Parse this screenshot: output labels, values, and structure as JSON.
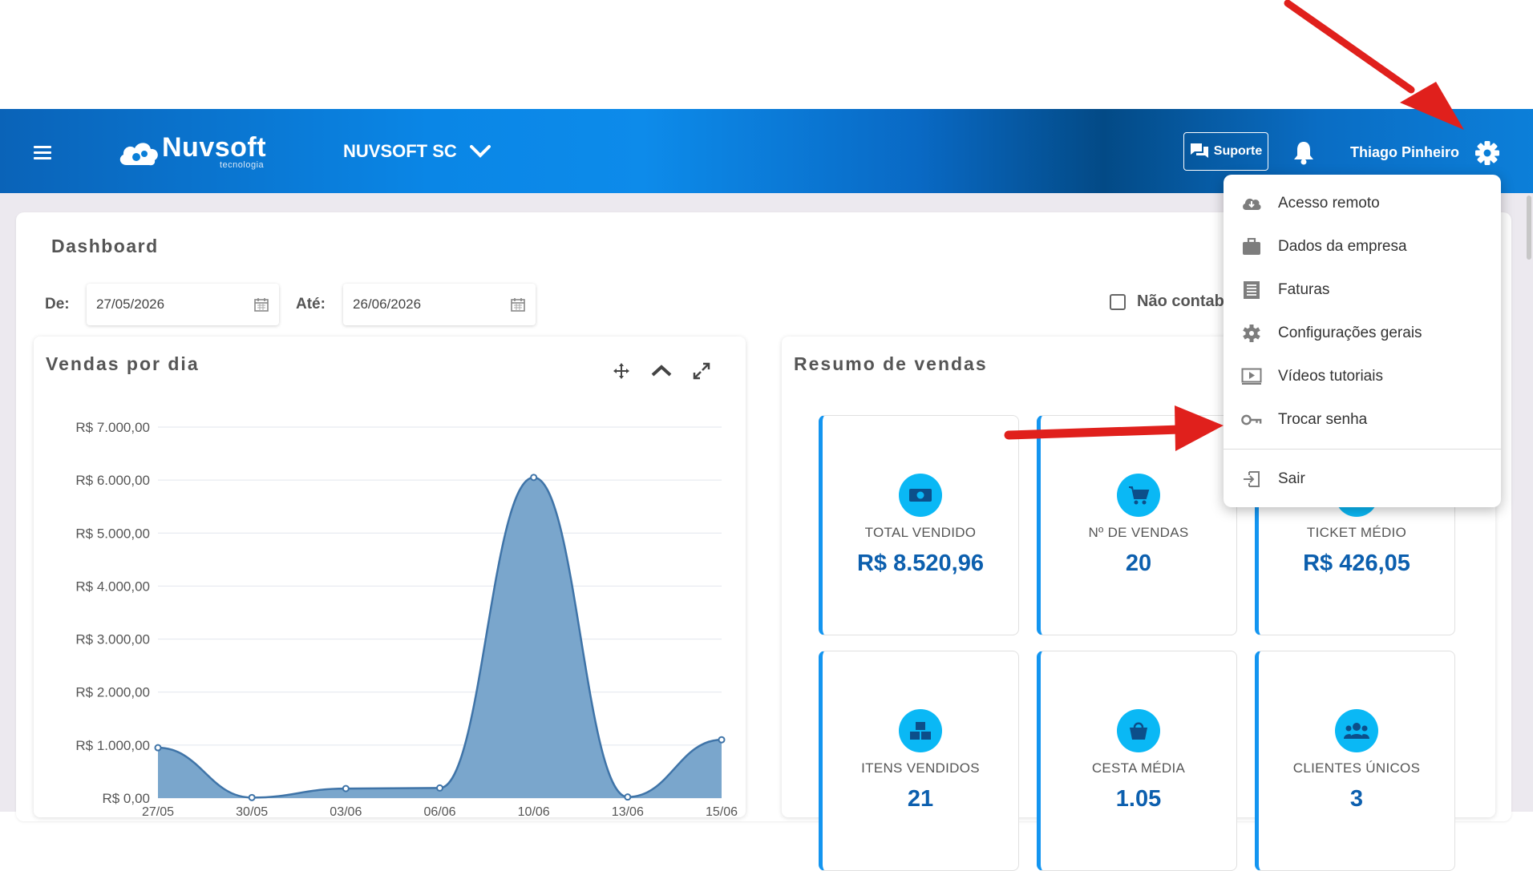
{
  "header": {
    "brand": "Nuvsoft",
    "brand_sub": "tecnologia",
    "company": "NUVSOFT SC",
    "support_label": "Suporte",
    "user_name": "Thiago Pinheiro"
  },
  "page": {
    "title": "Dashboard",
    "from_label": "De:",
    "from_value": "27/05/2026",
    "to_label": "Até:",
    "to_value": "26/06/2026",
    "checkbox_label": "Não contab"
  },
  "sales_chart_panel": {
    "title": "Vendas por dia"
  },
  "summary_panel": {
    "title": "Resumo de vendas",
    "cards": [
      {
        "label": "TOTAL VENDIDO",
        "value": "R$ 8.520,96",
        "icon": "money-icon"
      },
      {
        "label": "Nº DE VENDAS",
        "value": "20",
        "icon": "cart-icon"
      },
      {
        "label": "TICKET MÉDIO",
        "value": "R$ 426,05",
        "icon": "ticket-icon"
      },
      {
        "label": "ITENS VENDIDOS",
        "value": "21",
        "icon": "boxes-icon"
      },
      {
        "label": "CESTA MÉDIA",
        "value": "1.05",
        "icon": "basket-icon"
      },
      {
        "label": "CLIENTES ÚNICOS",
        "value": "3",
        "icon": "users-icon"
      }
    ]
  },
  "settings_menu": {
    "items": [
      {
        "label": "Acesso remoto",
        "icon": "cloud-download-icon"
      },
      {
        "label": "Dados da empresa",
        "icon": "briefcase-icon"
      },
      {
        "label": "Faturas",
        "icon": "receipt-icon"
      },
      {
        "label": "Configurações gerais",
        "icon": "gear-icon"
      },
      {
        "label": "Vídeos tutoriais",
        "icon": "video-icon"
      },
      {
        "label": "Trocar senha",
        "icon": "key-icon"
      },
      {
        "label": "Sair",
        "icon": "logout-icon"
      }
    ]
  },
  "colors": {
    "navbar": "#0a86e6",
    "accent": "#1395f0",
    "value_text": "#0c5fae",
    "icon_circle": "#0ab8f5",
    "chart_fill": "#7aa6cc",
    "chart_line": "#3f74a8",
    "annotation_arrow": "#e0201c"
  },
  "chart_data": {
    "type": "area",
    "x": [
      "27/05",
      "30/05",
      "03/06",
      "06/06",
      "10/06",
      "13/06",
      "15/06"
    ],
    "values": [
      950,
      10,
      180,
      190,
      6050,
      20,
      1100
    ],
    "yticks": [
      "R$ 0,00",
      "R$ 1.000,00",
      "R$ 2.000,00",
      "R$ 3.000,00",
      "R$ 4.000,00",
      "R$ 5.000,00",
      "R$ 6.000,00",
      "R$ 7.000,00"
    ],
    "ylim": [
      0,
      7000
    ],
    "grid": true
  }
}
